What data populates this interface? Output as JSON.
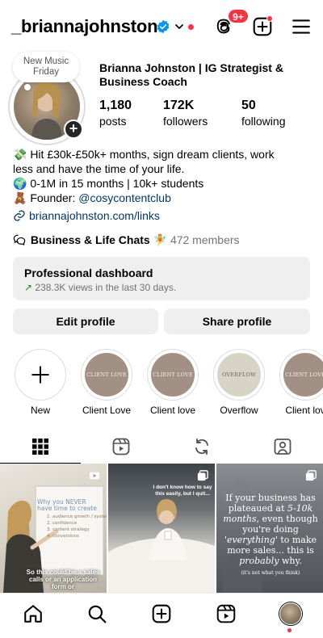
{
  "header": {
    "username": "_briannajohnston",
    "threads_badge": "9+"
  },
  "profile": {
    "note": "New Music Friday",
    "full_name": "Brianna Johnston | IG Strategist & Business Coach",
    "stats": [
      {
        "value": "1,180",
        "label": "posts"
      },
      {
        "value": "172K",
        "label": "followers"
      },
      {
        "value": "50",
        "label": "following"
      }
    ]
  },
  "bio": {
    "line1": "💸 Hit £30k-£50k+ months, sign dream clients, work",
    "line2": "less and have the time of your life.",
    "line3": "🌍 0-1M in 15 months | 10k+ students",
    "line4_prefix": "🧸 Founder: ",
    "line4_mention": "@cosycontentclub",
    "link": "briannajohnston.com/links"
  },
  "chats": {
    "title": "Business & Life Chats",
    "emoji": "🧚",
    "members": "472 members"
  },
  "dashboard": {
    "title": "Professional dashboard",
    "arrow": "↗",
    "subtitle": "238.3K views in the last 30 days."
  },
  "buttons": {
    "edit": "Edit profile",
    "share": "Share profile"
  },
  "highlights": [
    {
      "label": "New",
      "cover": ""
    },
    {
      "label": "Client Love",
      "cover": "CLIENT LOVE",
      "color": "#a39084"
    },
    {
      "label": "Client love",
      "cover": "CLIENT LOVE",
      "color": "#a39084"
    },
    {
      "label": "Overflow",
      "cover": "OVERFLOW",
      "color": "#d8d3c7"
    },
    {
      "label": "Client lov",
      "cover": "CLIENT LOVE",
      "color": "#a39084"
    }
  ],
  "posts": [
    {
      "top_text": "Why you NEVER have time to create",
      "list": "1. audience growth / systems\n2. confidence\n3. content strategy\n4. conversions",
      "caption": "So this could be a sales calls or an application form or"
    },
    {
      "top_text": "I don't know how to say this easily, but I quit..."
    },
    {
      "caption_a": "If your business has plateaued at ",
      "caption_b": "5-10k months",
      "caption_c": ", even though you're doing ",
      "caption_d": "'everything'",
      "caption_e": " to make more sales... this is ",
      "caption_f": "probably",
      "caption_g": " why.",
      "caption_small": "(it's not what you think)"
    }
  ]
}
